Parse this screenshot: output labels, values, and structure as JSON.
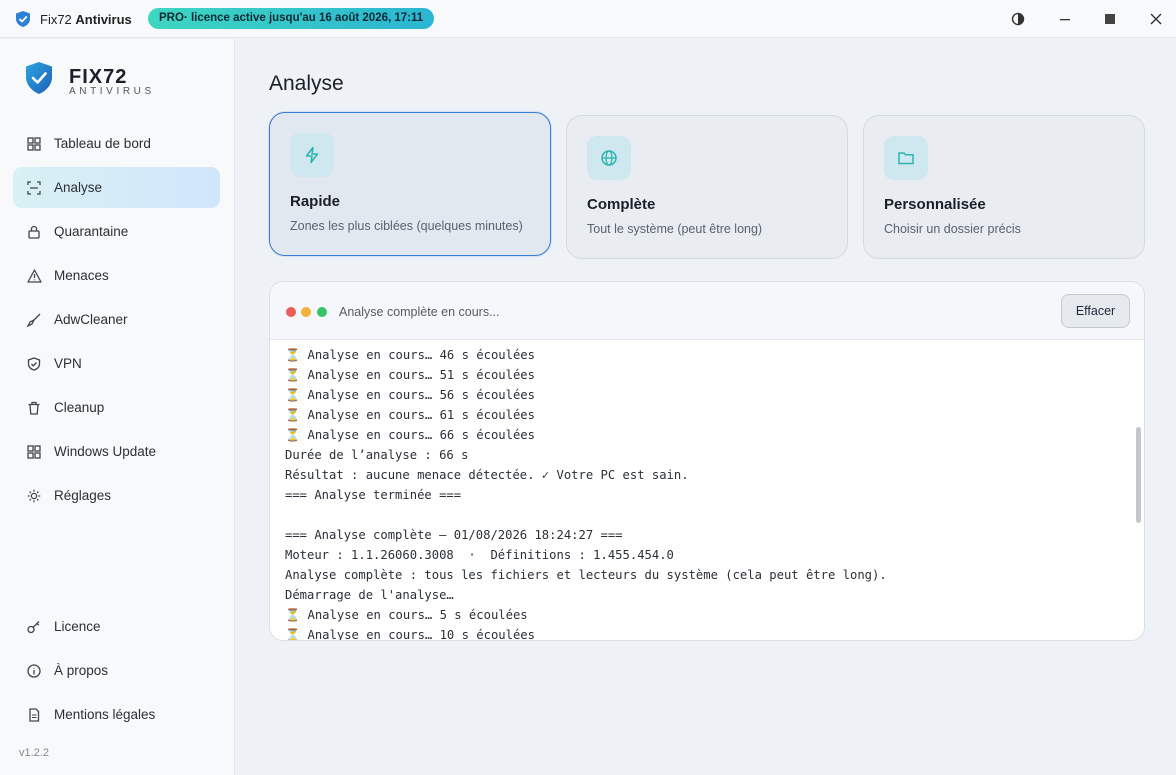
{
  "titlebar": {
    "app_name_prefix": "Fix72",
    "app_name_suffix": "Antivirus",
    "license_badge": "PRO· licence active jusqu'au 16 août 2026, 17:11"
  },
  "brand": {
    "name": "FIX72",
    "subtitle": "ANTIVIRUS"
  },
  "sidebar": {
    "items": [
      {
        "label": "Tableau de bord",
        "icon": "dashboard-icon"
      },
      {
        "label": "Analyse",
        "icon": "scan-icon",
        "active": true
      },
      {
        "label": "Quarantaine",
        "icon": "lock-icon"
      },
      {
        "label": "Menaces",
        "icon": "warning-icon"
      },
      {
        "label": "AdwCleaner",
        "icon": "broom-icon"
      },
      {
        "label": "VPN",
        "icon": "shield-icon"
      },
      {
        "label": "Cleanup",
        "icon": "trash-icon"
      },
      {
        "label": "Windows Update",
        "icon": "windows-icon"
      },
      {
        "label": "Réglages",
        "icon": "gear-icon"
      }
    ],
    "bottom_items": [
      {
        "label": "Licence",
        "icon": "key-icon"
      },
      {
        "label": "À propos",
        "icon": "info-icon"
      },
      {
        "label": "Mentions légales",
        "icon": "document-icon"
      }
    ],
    "version": "v1.2.2"
  },
  "main": {
    "title": "Analyse",
    "cards": [
      {
        "title": "Rapide",
        "desc": "Zones les plus ciblées (quelques minutes)",
        "icon": "lightning-icon",
        "selected": true
      },
      {
        "title": "Complète",
        "desc": "Tout le système (peut être long)",
        "icon": "globe-icon"
      },
      {
        "title": "Personnalisée",
        "desc": "Choisir un dossier précis",
        "icon": "folder-icon"
      }
    ]
  },
  "console": {
    "status": "Analyse complète en cours...",
    "clear_label": "Effacer",
    "lines": [
      "⏳ Analyse en cours… 46 s écoulées",
      "⏳ Analyse en cours… 51 s écoulées",
      "⏳ Analyse en cours… 56 s écoulées",
      "⏳ Analyse en cours… 61 s écoulées",
      "⏳ Analyse en cours… 66 s écoulées",
      "Durée de l’analyse : 66 s",
      "Résultat : aucune menace détectée. ✓ Votre PC est sain.",
      "=== Analyse terminée ===",
      "",
      "=== Analyse complète — 01/08/2026 18:24:27 ===",
      "Moteur : 1.1.26060.3008  ·  Définitions : 1.455.454.0",
      "Analyse complète : tous les fichiers et lecteurs du système (cela peut être long).",
      "Démarrage de l'analyse…",
      "⏳ Analyse en cours… 5 s écoulées",
      "⏳ Analyse en cours… 10 s écoulées"
    ]
  },
  "colors": {
    "accent": "#3a7bd5",
    "badge_start": "#3fd6c1",
    "badge_end": "#2bb5d2"
  }
}
